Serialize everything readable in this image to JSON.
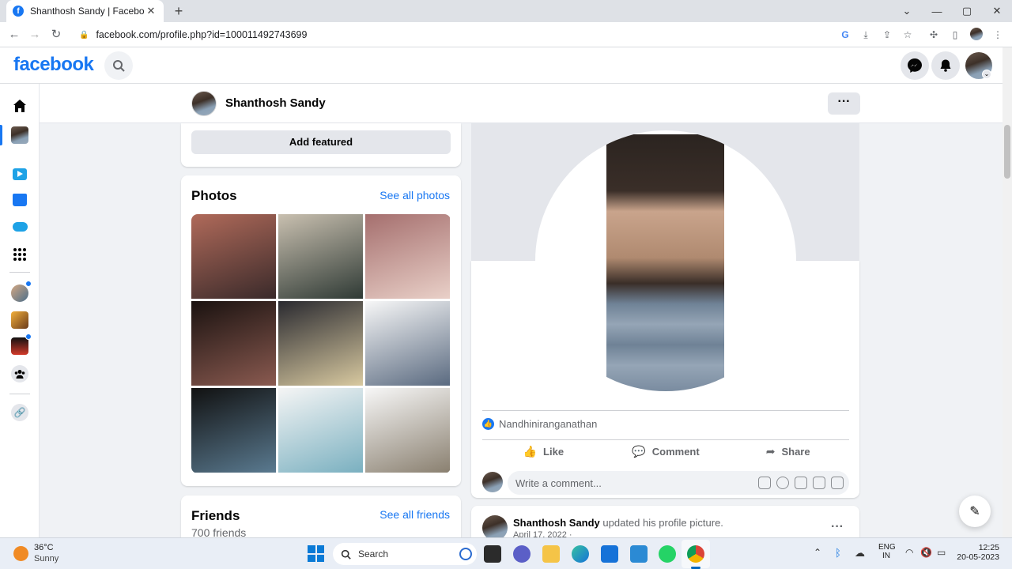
{
  "browser": {
    "tab_title": "Shanthosh Sandy | Facebook",
    "url": "facebook.com/profile.php?id=100011492743699"
  },
  "fb": {
    "logo": "facebook",
    "profile_name": "Shanthosh Sandy",
    "more_label": "···"
  },
  "featured": {
    "add_featured_label": "Add featured"
  },
  "photos": {
    "title": "Photos",
    "see_all": "See all photos",
    "items": [
      {
        "colors": [
          "#b06a5a",
          "#3a2a2a"
        ]
      },
      {
        "colors": [
          "#c9c0b0",
          "#2f3a35"
        ]
      },
      {
        "colors": [
          "#a56f6e",
          "#e9d0c8"
        ]
      },
      {
        "colors": [
          "#1a1210",
          "#8a5a50"
        ]
      },
      {
        "colors": [
          "#2a2a30",
          "#d8c9a0"
        ]
      },
      {
        "colors": [
          "#f7f7f7",
          "#5a6a80"
        ]
      },
      {
        "colors": [
          "#111111",
          "#5a7a90"
        ]
      },
      {
        "colors": [
          "#f5f5f5",
          "#7ab0c0"
        ]
      },
      {
        "colors": [
          "#f7f7f7",
          "#8a8070"
        ]
      }
    ]
  },
  "friends": {
    "title": "Friends",
    "see_all": "See all friends",
    "count": "700 friends"
  },
  "post": {
    "liker": "Nandhiniranganathan",
    "like": "Like",
    "comment": "Comment",
    "share": "Share",
    "comment_placeholder": "Write a comment...",
    "next_post_author": "Shanthosh Sandy",
    "next_post_action": "updated his profile picture.",
    "next_post_date": "April 17, 2022 ·"
  },
  "taskbar": {
    "temp": "36°C",
    "weather": "Sunny",
    "search": "Search",
    "lang1": "ENG",
    "lang2": "IN",
    "time": "12:25",
    "date": "20-05-2023"
  },
  "colors": {
    "brand": "#1877f2",
    "bg": "#f0f2f5"
  }
}
